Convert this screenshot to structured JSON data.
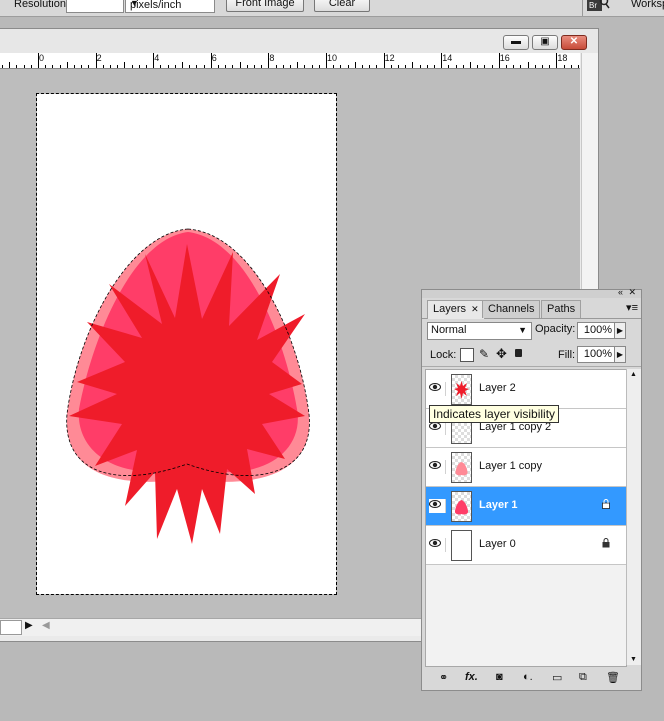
{
  "options_bar": {
    "resolution_label": "Resolution:",
    "resolution_value": "",
    "units_value": "pixels/inch",
    "front_image_label": "Front Image",
    "clear_label": "Clear",
    "workspace_label": "Worksp",
    "bridge_label": "Br"
  },
  "document": {
    "ruler_numbers": [
      "0",
      "2",
      "4",
      "6",
      "8",
      "10",
      "12",
      "14",
      "16",
      "18"
    ]
  },
  "layers_panel": {
    "tabs": [
      {
        "label": "Layers",
        "active": true
      },
      {
        "label": "Channels",
        "active": false
      },
      {
        "label": "Paths",
        "active": false
      }
    ],
    "blend_mode": "Normal",
    "opacity_label": "Opacity:",
    "opacity_value": "100%",
    "lock_label": "Lock:",
    "fill_label": "Fill:",
    "fill_value": "100%",
    "layers": [
      {
        "name": "Layer 2",
        "visible": true,
        "selected": false,
        "locked": false
      },
      {
        "name": "Layer 1 copy 2",
        "visible": true,
        "selected": false,
        "locked": false
      },
      {
        "name": "Layer 1 copy",
        "visible": true,
        "selected": false,
        "locked": false
      },
      {
        "name": "Layer 1",
        "visible": true,
        "selected": true,
        "locked": true
      },
      {
        "name": "Layer 0",
        "visible": true,
        "selected": false,
        "locked": true
      }
    ],
    "tooltip": "Indicates layer visibility",
    "footer_icons": [
      "link-icon",
      "fx-icon",
      "mask-icon",
      "adjustment-icon",
      "folder-icon",
      "new-layer-icon",
      "trash-icon"
    ]
  },
  "colors": {
    "selected_layer": "#3399ff",
    "strawberry_dark": "#ef1c2a",
    "strawberry_mid": "#ff3d68",
    "strawberry_light": "#ff8a96"
  }
}
